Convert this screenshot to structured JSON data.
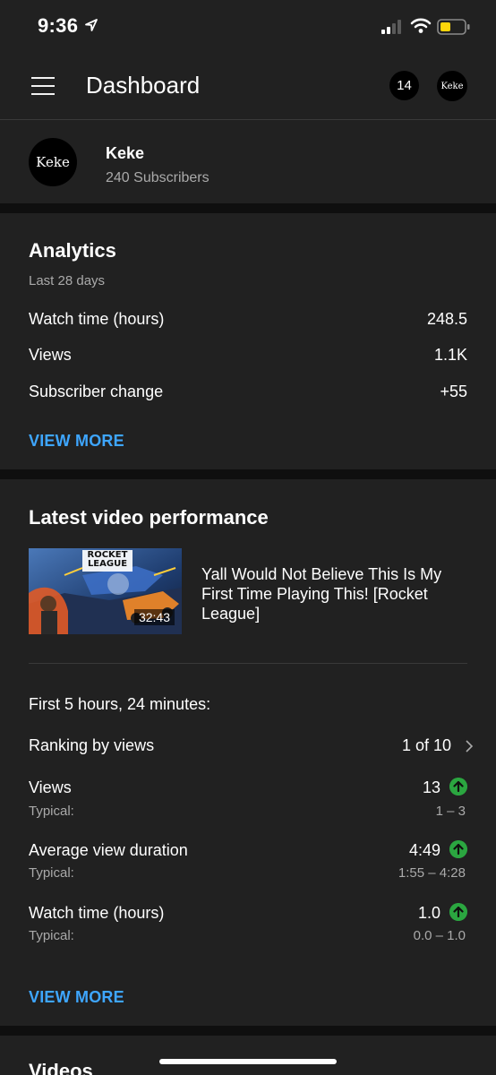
{
  "status_bar": {
    "time": "9:36"
  },
  "header": {
    "title": "Dashboard",
    "notification_count": "14",
    "avatar_text": "Keke"
  },
  "channel": {
    "avatar_text": "Keke",
    "name": "Keke",
    "subscribers": "240 Subscribers"
  },
  "analytics": {
    "title": "Analytics",
    "period": "Last 28 days",
    "metrics": [
      {
        "label": "Watch time (hours)",
        "value": "248.5"
      },
      {
        "label": "Views",
        "value": "1.1K"
      },
      {
        "label": "Subscriber change",
        "value": "+55"
      }
    ],
    "view_more": "VIEW MORE"
  },
  "latest_video": {
    "title": "Latest video performance",
    "thumbnail_text": "ROCKET LEAGUE",
    "duration": "32:43",
    "video_title": "Yall Would Not Believe This Is My First Time Playing This! [Rocket League]",
    "period_label": "First 5 hours, 24 minutes:",
    "ranking_label": "Ranking by views",
    "ranking_value": "1 of 10",
    "stats": [
      {
        "label": "Views",
        "value": "13",
        "typical_label": "Typical:",
        "typical": "1 – 3"
      },
      {
        "label": "Average view duration",
        "value": "4:49",
        "typical_label": "Typical:",
        "typical": "1:55 – 4:28"
      },
      {
        "label": "Watch time (hours)",
        "value": "1.0",
        "typical_label": "Typical:",
        "typical": "0.0 – 1.0"
      }
    ],
    "view_more": "VIEW MORE"
  },
  "videos": {
    "title": "Videos"
  },
  "colors": {
    "background": "#0f0f0f",
    "card": "#212121",
    "link": "#3ea6ff",
    "up_green": "#2ba640",
    "secondary_text": "#aaaaaa"
  }
}
